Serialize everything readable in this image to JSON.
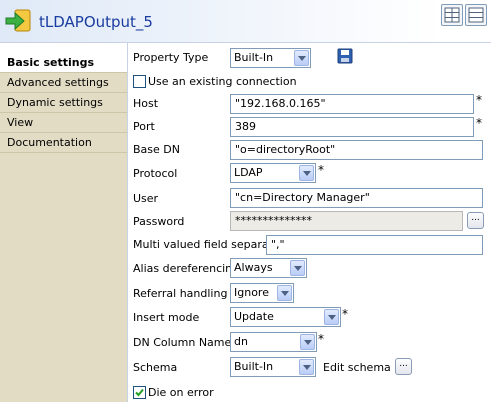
{
  "component": {
    "title": "tLDAPOutput_5"
  },
  "sidebar": {
    "items": [
      {
        "label": "Basic settings",
        "active": true
      },
      {
        "label": "Advanced settings",
        "active": false
      },
      {
        "label": "Dynamic settings",
        "active": false
      },
      {
        "label": "View",
        "active": false
      },
      {
        "label": "Documentation",
        "active": false
      }
    ]
  },
  "form": {
    "property_type": {
      "label": "Property Type",
      "value": "Built-In"
    },
    "use_existing": {
      "label": "Use an existing connection",
      "checked": false
    },
    "host": {
      "label": "Host",
      "value": "\"192.168.0.165\"",
      "required": "*"
    },
    "port": {
      "label": "Port",
      "value": "389",
      "required": "*"
    },
    "base_dn": {
      "label": "Base DN",
      "value": "\"o=directoryRoot\""
    },
    "protocol": {
      "label": "Protocol",
      "value": "LDAP",
      "required": "*"
    },
    "user": {
      "label": "User",
      "value": "\"cn=Directory Manager\""
    },
    "password": {
      "label": "Password",
      "value": "**************"
    },
    "multi_sep": {
      "label": "Multi valued field separator",
      "value": "\",\""
    },
    "alias_deref": {
      "label": "Alias dereferencing",
      "value": "Always"
    },
    "referral": {
      "label": "Referral handling",
      "value": "Ignore"
    },
    "insert_mode": {
      "label": "Insert mode",
      "value": "Update",
      "required": "*"
    },
    "dn_column": {
      "label": "DN Column Name",
      "value": "dn",
      "required": "*"
    },
    "schema": {
      "label": "Schema",
      "value": "Built-In",
      "edit_label": "Edit schema"
    },
    "die_on_error": {
      "label": "Die on error",
      "checked": true
    },
    "dots": "..."
  },
  "colors": {
    "title": "#1a3ca0",
    "sidebar_bg": "#e2dcc4",
    "field_border": "#7f9db9"
  }
}
